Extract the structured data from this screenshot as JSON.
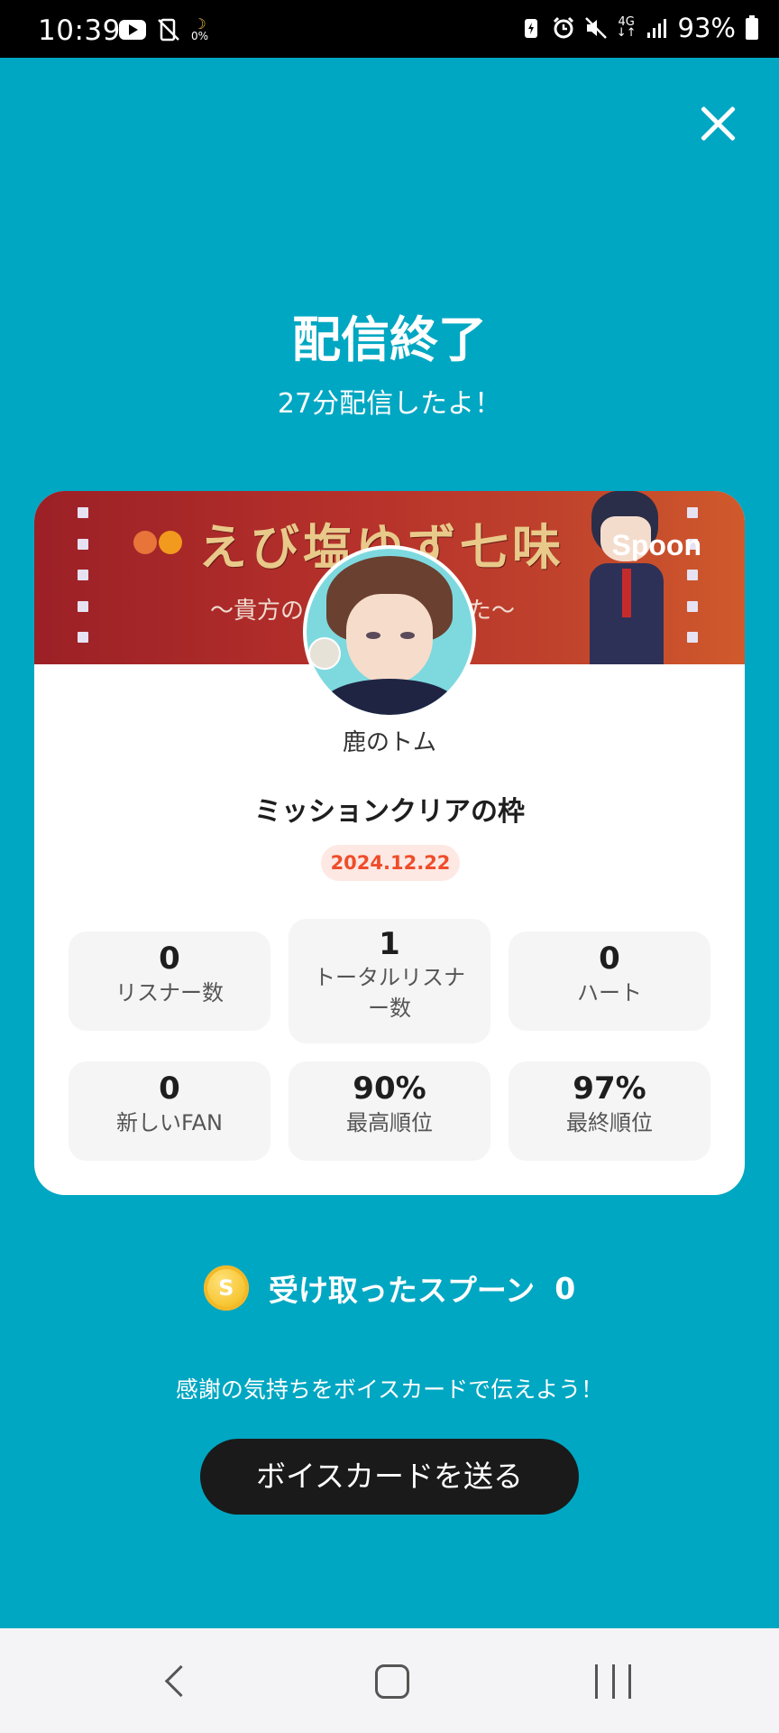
{
  "status_bar": {
    "time": "10:39",
    "moon_percent": "0%",
    "network": "4G",
    "battery": "93%",
    "icons": [
      "youtube-icon",
      "no-screen-icon",
      "moon-icon",
      "battery-saver-icon",
      "alarm-icon",
      "mute-icon",
      "4g-icon",
      "signal-icon",
      "battery-icon"
    ]
  },
  "header": {
    "close_icon": "close-icon",
    "title": "配信終了",
    "subtitle": "27分配信したよ！"
  },
  "card": {
    "banner": {
      "title": "えび塩ゆず七味",
      "subtitle": "〜貴方の　　　　　　した〜",
      "brand": "Spoon"
    },
    "username": "鹿のトム",
    "live_title": "ミッションクリアの枠",
    "date": "2024.12.22",
    "stats": [
      {
        "value": "0",
        "label": "リスナー数"
      },
      {
        "value": "1",
        "label": "トータルリスナ\nー数"
      },
      {
        "value": "0",
        "label": "ハート"
      },
      {
        "value": "0",
        "label": "新しいFAN"
      },
      {
        "value": "90%",
        "label": "最高順位"
      },
      {
        "value": "97%",
        "label": "最終順位"
      }
    ]
  },
  "spoons": {
    "coin_letter": "S",
    "label": "受け取ったスプーン",
    "count": "0"
  },
  "thanks_text": "感謝の気持ちをボイスカードで伝えよう！",
  "voice_card_button": "ボイスカードを送る",
  "nav": {
    "back_icon": "back-icon",
    "home_icon": "home-icon",
    "recents_icon": "recents-icon"
  }
}
